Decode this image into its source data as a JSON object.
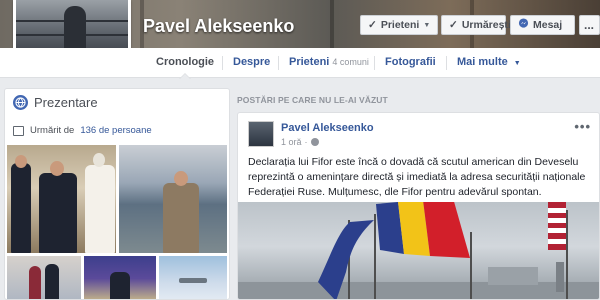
{
  "profile": {
    "name": "Pavel Alekseenko",
    "buttons": {
      "friends": "Prieteni",
      "follow": "Urmărești",
      "message": "Mesaj",
      "more": "..."
    }
  },
  "tabs": [
    {
      "label": "Cronologie",
      "active": true
    },
    {
      "label": "Despre"
    },
    {
      "label": "Prieteni",
      "sub": "4 comuni"
    },
    {
      "label": "Fotografii"
    },
    {
      "label": "Mai multe"
    }
  ],
  "intro": {
    "title": "Prezentare",
    "follow_prefix": "Urmărit de",
    "follow_count": "136 de persoane"
  },
  "feed": {
    "label": "POSTĂRI PE CARE NU LE-AI VĂZUT",
    "post": {
      "author": "Pavel Alekseenko",
      "time": "1 oră",
      "menu": "•••",
      "text": "Declarația lui Fifor este încă o dovadă că scutul american din Deveselu reprezintă o amenințare directă și imediată la adresa securității naționale Federației Ruse. Mulțumesc, dle Fifor pentru adevărul spontan."
    }
  },
  "colors": {
    "link": "#365899",
    "page_bg": "#e9ebee",
    "flag_blue": "#2b3f8c",
    "flag_yellow": "#f2c318",
    "flag_red": "#d21f2a"
  },
  "icons": {
    "check": "check-icon",
    "rss": "rss-icon",
    "globe": "globe-icon",
    "messenger": "messenger-icon"
  }
}
